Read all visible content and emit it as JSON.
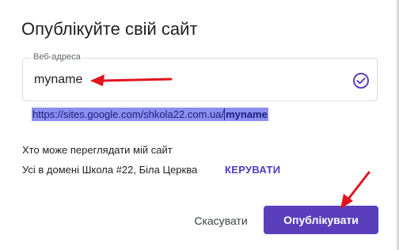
{
  "dialog": {
    "title": "Опублікуйте свій сайт",
    "web_address": {
      "label": "Веб-адреса",
      "value": "myname",
      "status_icon": "check-circle-icon"
    },
    "url": {
      "prefix": "https://sites.google.com/shkola22.com.ua/",
      "name": "myname",
      "selected": true
    },
    "viewers": {
      "heading": "Хто може переглядати мій сайт",
      "text": "Усі в домені Школа #22, Біла Церква",
      "manage_label": "КЕРУВАТИ"
    },
    "actions": {
      "cancel_label": "Скасувати",
      "publish_label": "Опублікувати"
    }
  },
  "annotations": {
    "arrow_color": "#e0141e"
  },
  "colors": {
    "accent": "#5a3fbd",
    "link": "#4e3cc0",
    "selection": "#8c8ef0"
  }
}
